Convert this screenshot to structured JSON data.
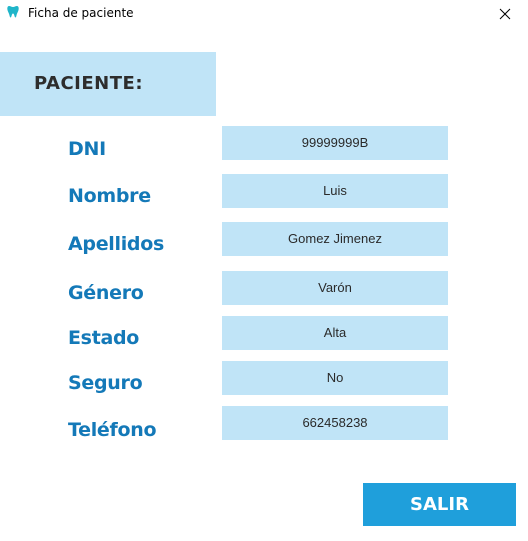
{
  "window": {
    "title": "Ficha de paciente",
    "app_icon": "tooth-icon",
    "close_icon": "close-icon"
  },
  "header": {
    "title": "PACIENTE:"
  },
  "fields": [
    {
      "label": "DNI",
      "value": "99999999B"
    },
    {
      "label": "Nombre",
      "value": "Luis"
    },
    {
      "label": "Apellidos",
      "value": "Gomez Jimenez"
    },
    {
      "label": "Género",
      "value": "Varón"
    },
    {
      "label": "Estado",
      "value": "Alta"
    },
    {
      "label": "Seguro",
      "value": "No"
    },
    {
      "label": "Teléfono",
      "value": "662458238"
    }
  ],
  "actions": {
    "exit_label": "SALIR"
  },
  "colors": {
    "accent": "#1f9fdb",
    "label": "#1479b8",
    "field_bg": "#c0e4f7"
  }
}
